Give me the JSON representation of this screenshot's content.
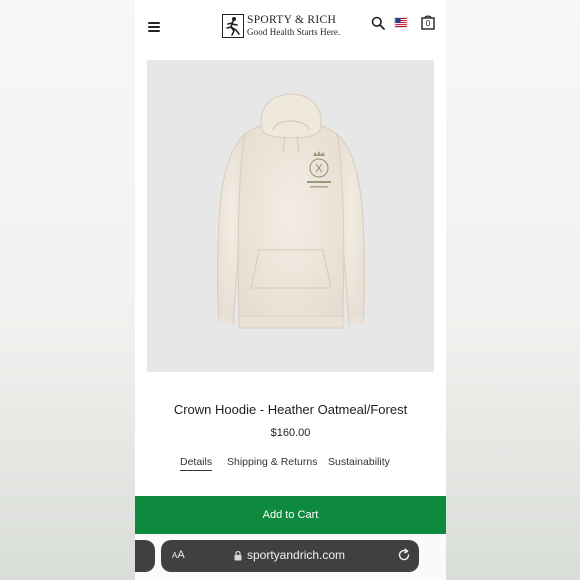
{
  "brand": {
    "name": "SPORTY & RICH",
    "tagline": "Good Health Starts Here."
  },
  "header": {
    "menu_icon": "hamburger-icon",
    "search_icon": "search-icon",
    "flag_icon": "us-flag-icon",
    "bag_icon": "shopping-bag-icon",
    "bag_count": "0"
  },
  "product": {
    "title": "Crown Hoodie - Heather Oatmeal/Forest",
    "price": "$160.00",
    "image_icon": "hoodie-image"
  },
  "tabs": [
    {
      "label": "Details",
      "active": true
    },
    {
      "label": "Shipping & Returns",
      "active": false
    },
    {
      "label": "Sustainability",
      "active": false
    }
  ],
  "cta": {
    "label": "Add to Cart",
    "color": "#0e8a3e"
  },
  "browser": {
    "text_size_label": "AA",
    "lock_icon": "lock-icon",
    "url": "sportyandrich.com",
    "reload_icon": "reload-icon"
  }
}
